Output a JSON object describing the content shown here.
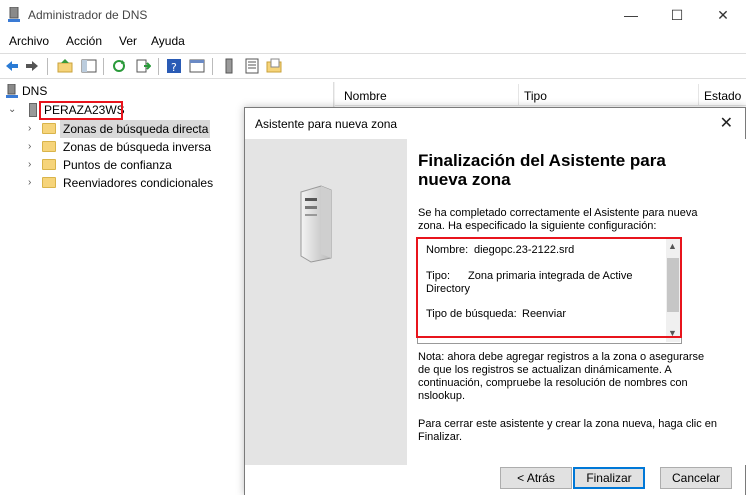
{
  "window": {
    "title": "Administrador de DNS",
    "minimize": "—",
    "maximize": "☐",
    "close": "✕"
  },
  "menu": [
    "Archivo",
    "Acción",
    "Ver",
    "Ayuda"
  ],
  "tree": {
    "root": "DNS",
    "server": "PERAZA23WS",
    "items": [
      "Zonas de búsqueda directa",
      "Zonas de búsqueda inversa",
      "Puntos de confianza",
      "Reenviadores condicionales"
    ]
  },
  "list": {
    "columns": [
      "Nombre",
      "Tipo",
      "Estado"
    ]
  },
  "dialog": {
    "title": "Asistente para nueva zona",
    "close": "✕",
    "heading": "Finalización del Asistente para nueva zona",
    "intro": "Se ha completado correctamente el Asistente para nueva zona. Ha especificado la siguiente configuración:",
    "summary": {
      "name_label": "Nombre:",
      "name_value": "diegopc.23-2122.srd",
      "type_label": "Tipo:",
      "type_value_1": "Zona primaria integrada de Active",
      "type_value_2": "Directory",
      "lookup_label": "Tipo de búsqueda:",
      "lookup_value": "Reenviar"
    },
    "note": "Nota: ahora debe agregar registros a la zona o asegurarse de que los registros se actualizan dinámicamente. A continuación, compruebe la resolución de nombres con nslookup.",
    "finish_text": "Para cerrar este asistente y crear la zona nueva, haga clic en Finalizar.",
    "buttons": {
      "back": "< Atrás",
      "finish": "Finalizar",
      "cancel": "Cancelar"
    }
  },
  "colors": {
    "highlight": "#e8141c",
    "selection": "#d9d9d9",
    "primary_border": "#0078d7"
  }
}
